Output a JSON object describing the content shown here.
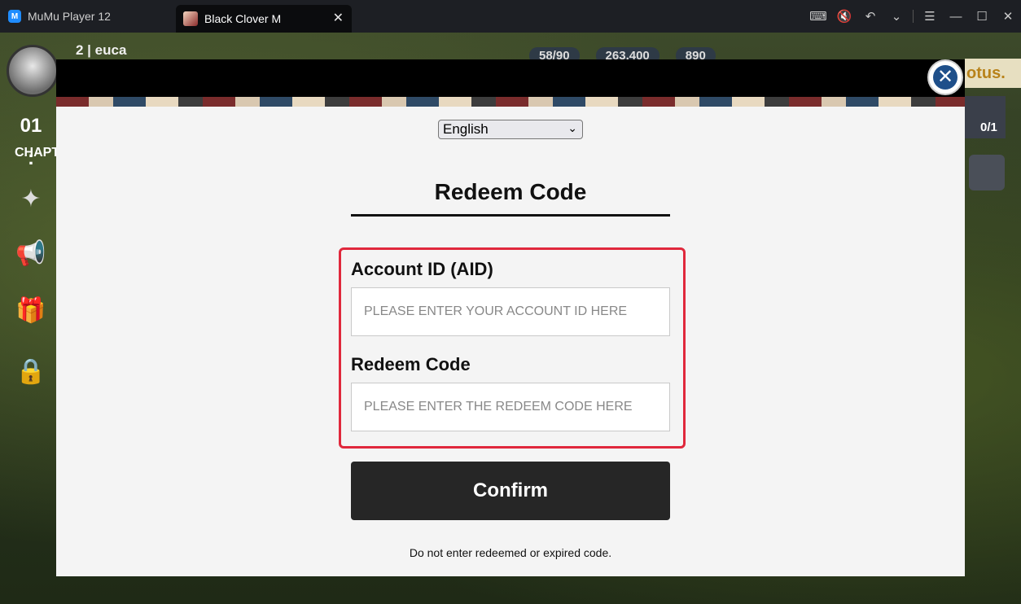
{
  "titlebar": {
    "app_name": "MuMu Player 12",
    "tab_title": "Black Clover M",
    "tab_close": "✕",
    "controls": [
      "⌨",
      "🔇",
      "↶",
      "⌄",
      "☰",
      "—",
      "☐",
      "✕"
    ]
  },
  "game": {
    "player_name": "2 | euca",
    "stamina": "58/90",
    "gold": "263,400",
    "gems": "890",
    "timer": "01 :",
    "chapter": "CHAPT",
    "lotus_text": "otus.",
    "quest_count": "0/1"
  },
  "modal": {
    "close_label": "✕",
    "language": {
      "selected": "English",
      "chevron": "⌄"
    },
    "title": "Redeem Code",
    "account_label": "Account ID (AID)",
    "account_placeholder": "PLEASE ENTER YOUR ACCOUNT ID HERE",
    "code_label": "Redeem Code",
    "code_placeholder": "PLEASE ENTER THE REDEEM CODE HERE",
    "confirm_label": "Confirm",
    "note": "Do not enter redeemed or expired code."
  },
  "colors": {
    "highlight_border": "#e0283c",
    "confirm_bg": "#262626",
    "close_icon_bg": "#1e4f8a"
  }
}
